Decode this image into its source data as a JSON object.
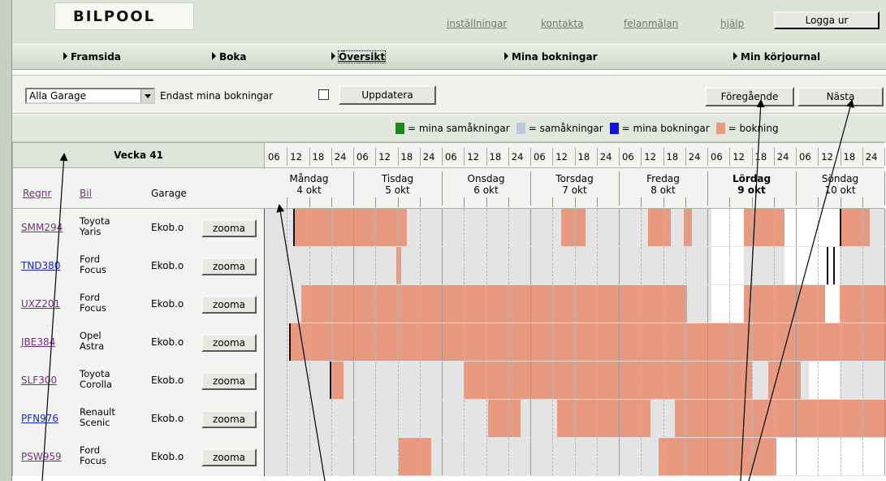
{
  "header": {
    "logo": "BILPOOL",
    "links": [
      "inställningar",
      "kontakta",
      "felanmälan",
      "hjälp"
    ],
    "logout": "Logga ur"
  },
  "nav": [
    "Framsida",
    "Boka",
    "Översikt",
    "Mina bokningar",
    "Min körjournal"
  ],
  "filter": {
    "garage_value": "Alla Garage",
    "only_mine_label": "Endast mina bokningar",
    "update": "Uppdatera",
    "prev": "Föregående",
    "next": "Nästa"
  },
  "legend": [
    {
      "color": "#1a8a1a",
      "label": "= mina samåkningar"
    },
    {
      "color": "#b9c8de",
      "label": "= samåkningar"
    },
    {
      "color": "#1010e8",
      "label": "= mina bokningar"
    },
    {
      "color": "#e89a80",
      "label": "= bokning"
    }
  ],
  "grid": {
    "week": "Vecka 41",
    "col_regnr": "Regnr",
    "col_bil": "Bil",
    "col_garage": "Garage",
    "hours": [
      "06",
      "12",
      "18",
      "24"
    ],
    "days": [
      {
        "name": "Måndag",
        "date": "4 okt",
        "bold": false
      },
      {
        "name": "Tisdag",
        "date": "5 okt",
        "bold": false
      },
      {
        "name": "Onsdag",
        "date": "6 okt",
        "bold": false
      },
      {
        "name": "Torsdag",
        "date": "7 okt",
        "bold": false
      },
      {
        "name": "Fredag",
        "date": "8 okt",
        "bold": false
      },
      {
        "name": "Lördag",
        "date": "9 okt",
        "bold": true
      },
      {
        "name": "Söndag",
        "date": "10 okt",
        "bold": false
      }
    ],
    "zoom_label": "zooma",
    "rows": [
      {
        "regnr": "SMM294",
        "bil": [
          "Toyota",
          "Yaris"
        ],
        "garage": "Ekob.o",
        "link_color": "purple"
      },
      {
        "regnr": "TND380",
        "bil": [
          "Ford",
          "Focus"
        ],
        "garage": "Ekob.o",
        "link_color": "blue"
      },
      {
        "regnr": "UXZ201",
        "bil": [
          "Ford",
          "Focus"
        ],
        "garage": "Ekob.o",
        "link_color": "purple"
      },
      {
        "regnr": "JBE384",
        "bil": [
          "Opel",
          "Astra"
        ],
        "garage": "Ekob.o",
        "link_color": "purple"
      },
      {
        "regnr": "SLF300",
        "bil": [
          "Toyota",
          "Corolla"
        ],
        "garage": "Ekob.o",
        "link_color": "purple"
      },
      {
        "regnr": "PFN976",
        "bil": [
          "Renault",
          "Scenic"
        ],
        "garage": "Ekob.o",
        "link_color": "blue"
      },
      {
        "regnr": "PSW959",
        "bil": [
          "Ford",
          "Focus"
        ],
        "garage": "Ekob.o",
        "link_color": "purple"
      }
    ]
  },
  "colors": {
    "booking": "#e89a80",
    "free_weekend": "#ffffff",
    "empty": "#e4e4e4",
    "link_purple": "#7a2a8a",
    "link_blue": "#1a22c8"
  }
}
